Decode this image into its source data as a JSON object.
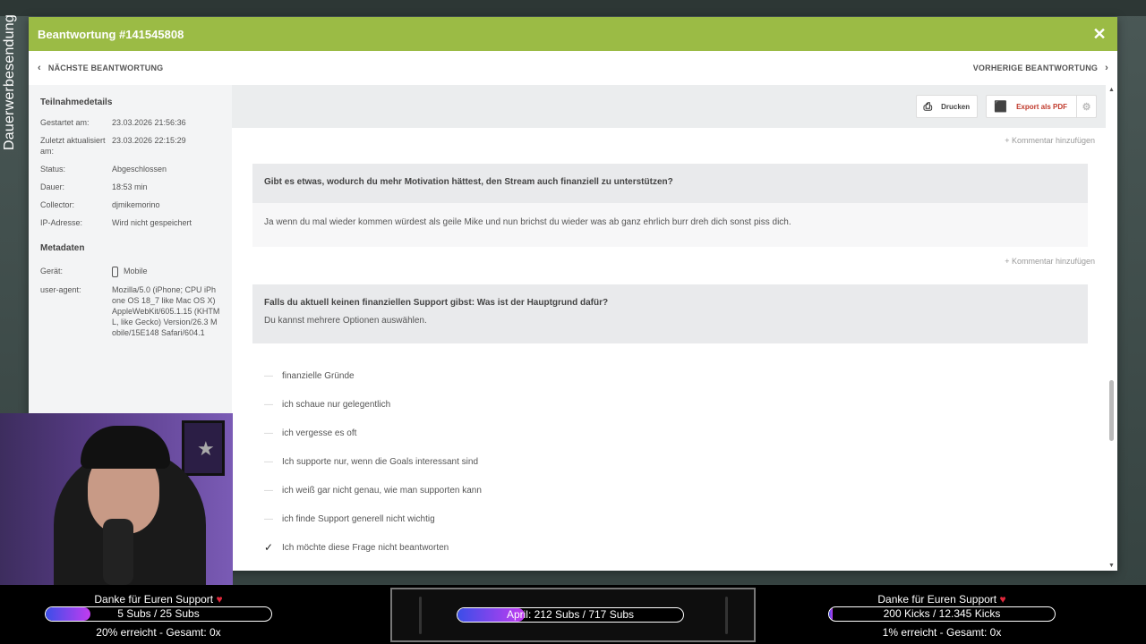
{
  "overlay": {
    "side_label": "Dauerwerbesendung"
  },
  "modal": {
    "title": "Beantwortung #141545808",
    "close_icon": "close-icon",
    "next_label": "NÄCHSTE BEANTWORTUNG",
    "prev_label": "VORHERIGE BEANTWORTUNG",
    "accent_color": "#9bbb45"
  },
  "sidebar": {
    "details_heading": "Teilnahmedetails",
    "details": [
      {
        "key": "Gestartet am:",
        "value": "23.03.2026 21:56:36"
      },
      {
        "key": "Zuletzt aktualisiert am:",
        "value": "23.03.2026 22:15:29"
      },
      {
        "key": "Status:",
        "value": "Abgeschlossen"
      },
      {
        "key": "Dauer:",
        "value": "18:53 min"
      },
      {
        "key": "Collector:",
        "value": "djmikemorino"
      },
      {
        "key": "IP-Adresse:",
        "value": "Wird nicht gespeichert"
      }
    ],
    "metadata_heading": "Metadaten",
    "device_key": "Gerät:",
    "device_value": "Mobile",
    "ua_key": "user-agent:",
    "ua_value": "Mozilla/5.0 (iPhone; CPU iPhone OS 18_7 like Mac OS X) AppleWebKit/605.1.15 (KHTML, like Gecko) Version/26.3 Mobile/15E148 Safari/604.1"
  },
  "toolbar": {
    "print_label": "Drucken",
    "pdf_label": "Export als PDF"
  },
  "main": {
    "comment_link": "+ Kommentar hinzufügen",
    "q1": {
      "text": "Gibt es etwas, wodurch du mehr Motivation hättest, den Stream auch finanziell zu unterstützen?",
      "answer": "Ja wenn du mal wieder kommen würdest als geile Mike  und nun brichst du wieder was ab ganz ehrlich burr dreh dich sonst piss dich."
    },
    "q2": {
      "text": "Falls du aktuell keinen finanziellen Support gibst: Was ist der Hauptgrund dafür?",
      "hint": "Du kannst mehrere Optionen auswählen.",
      "options": [
        {
          "label": "finanzielle Gründe",
          "checked": false
        },
        {
          "label": "ich schaue nur gelegentlich",
          "checked": false
        },
        {
          "label": "ich vergesse es oft",
          "checked": false
        },
        {
          "label": "Ich supporte nur, wenn die Goals interessant sind",
          "checked": false
        },
        {
          "label": "ich weiß gar nicht genau, wie man supporten kann",
          "checked": false
        },
        {
          "label": "ich finde Support generell nicht wichtig",
          "checked": false
        },
        {
          "label": "Ich möchte diese Frage nicht beantworten",
          "checked": true
        }
      ]
    }
  },
  "stream_bar": {
    "left": {
      "title": "Danke für Euren Support",
      "bar_text": "5 Subs / 25 Subs",
      "progress": 0.2,
      "sub": "20% erreicht - Gesamt: 0x"
    },
    "center": {
      "bar_text": "April: 212 Subs / 717 Subs",
      "progress": 0.296
    },
    "right": {
      "title": "Danke für Euren Support",
      "bar_text": "200 Kicks / 12.345 Kicks",
      "progress": 0.016,
      "sub": "1% erreicht - Gesamt: 0x"
    }
  }
}
